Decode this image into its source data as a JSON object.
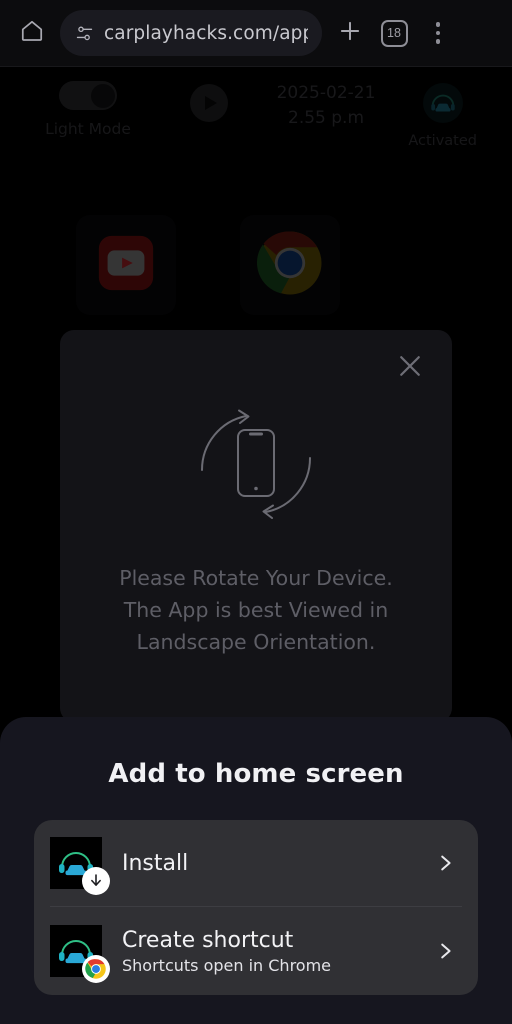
{
  "browser": {
    "home_icon": "home-icon",
    "url_icon": "page-info-icon",
    "url_text": "carplayhacks.com/apps/i",
    "new_tab_icon": "plus-icon",
    "tab_count": "18",
    "menu_icon": "more-vertical-icon"
  },
  "app": {
    "toggle": {
      "label": "Light Mode",
      "state": "on"
    },
    "play": {
      "icon": "play-icon"
    },
    "clock": {
      "date": "2025-02-21",
      "time": "2.55 p.m"
    },
    "car_status": {
      "icon": "car-headphones-icon",
      "label": "Activated"
    },
    "apps": [
      {
        "name": "YouTube",
        "icon": "youtube-icon"
      },
      {
        "name": "Chrome",
        "icon": "chrome-icon"
      }
    ]
  },
  "rotate_modal": {
    "close_icon": "close-icon",
    "illustration": "rotate-device-icon",
    "message": "Please Rotate Your Device. The App is best Viewed in Landscape Orientation."
  },
  "add_to_home_sheet": {
    "title": "Add to home screen",
    "options": [
      {
        "title": "Install",
        "subtitle": "",
        "icon": "carplayhacks-app-icon",
        "badge": "download-icon",
        "chevron": "chevron-right-icon"
      },
      {
        "title": "Create shortcut",
        "subtitle": "Shortcuts open in Chrome",
        "icon": "carplayhacks-app-icon",
        "badge": "chrome-icon",
        "chevron": "chevron-right-icon"
      }
    ]
  },
  "colors": {
    "sheet_bg": "#16161f",
    "card_bg": "#303034",
    "accent_teal": "#2ec4c4",
    "modal_bg": "#131317",
    "browser_bg": "#0c0c0e"
  }
}
